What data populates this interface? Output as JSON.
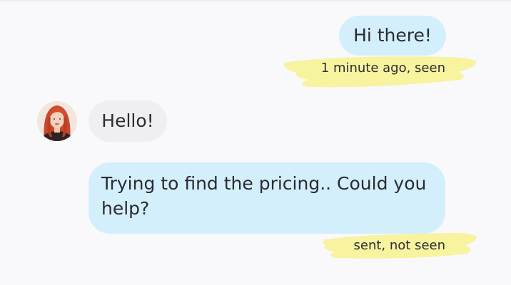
{
  "conversation": {
    "messages": [
      {
        "direction": "outgoing",
        "text": "Hi there!"
      },
      {
        "direction": "incoming",
        "text": "Hello!"
      },
      {
        "direction": "outgoing",
        "text": "Trying to find the pricing.. Could you help?"
      }
    ],
    "statuses": [
      {
        "text": "1 minute ago, seen"
      },
      {
        "text": "sent, not seen"
      }
    ]
  },
  "colors": {
    "outgoing_bubble": "#d4effc",
    "incoming_bubble": "#efeff2",
    "highlight": "#f7f29a",
    "background": "#f9f8fb"
  }
}
